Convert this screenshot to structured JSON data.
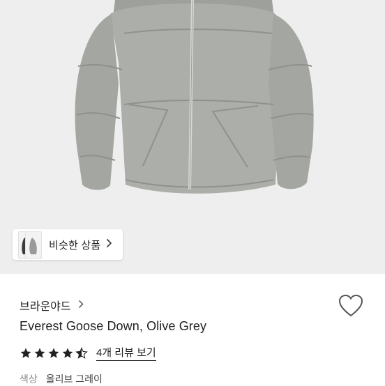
{
  "product": {
    "brand": "브라운야드",
    "title": "Everest Goose Down, Olive Grey",
    "rating_value": 4.5,
    "rating_max": 5,
    "review_link": "4개 리뷰 보기",
    "color_label": "색상",
    "color_value": "올리브 그레이"
  },
  "similar": {
    "label": "비슷한 상품"
  },
  "icons": {
    "brand_arrow": "chevron-right-icon",
    "similar_arrow": "chevron-right-icon",
    "wishlist": "heart-icon"
  },
  "colors": {
    "background": "#eeeeee",
    "jacket": "#a9aca6",
    "star": "#222222"
  }
}
